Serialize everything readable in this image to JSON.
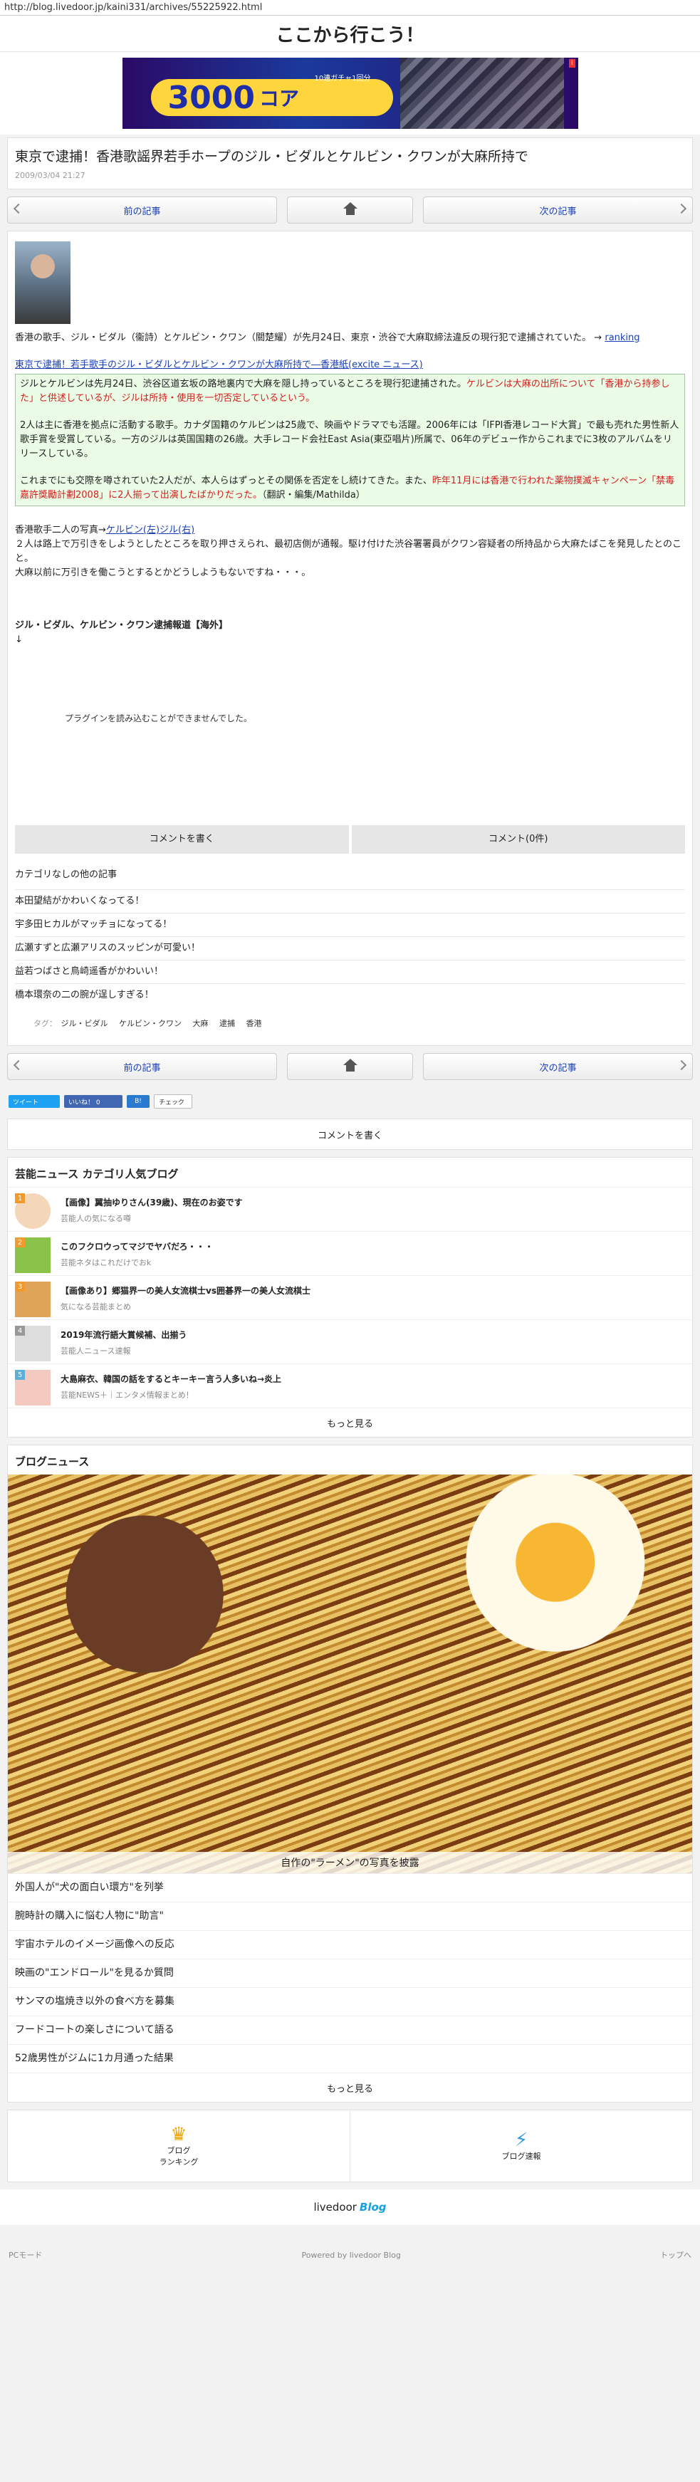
{
  "browser": {
    "url": "http://blog.livedoor.jp/kaini331/archives/55225922.html"
  },
  "site": {
    "title": "ここから行こう！"
  },
  "ad": {
    "number": "3000",
    "unit": "コア",
    "note": "10連ガチャ1回分"
  },
  "article": {
    "title": "東京で逮捕！香港歌謡界若手ホープのジル・ビダルとケルビン・クワンが大麻所持で",
    "date": "2009/03/04 21:27",
    "intro": "香港の歌手、ジル・ビダル（衞詩）とケルビン・クワン（關楚耀）が先月24日、東京・渋谷で大麻取締法違反の現行犯で逮捕されていた。",
    "ranking_arrow": "→",
    "ranking_link": "ranking",
    "source_link": "東京で逮捕！若手歌手のジル・ビダルとケルビン・クワンが大麻所持で―香港紙(excite ニュース)",
    "quote_p1_a": "ジルとケルビンは先月24日、渋谷区道玄坂の路地裏内で大麻を隠し持っているところを現行犯逮捕された。",
    "quote_p1_b": "ケルビンは大麻の出所について「香港から持参した」と供述しているが、ジルは所持・使用を一切否定しているという。",
    "quote_p2": "2人は主に香港を拠点に活動する歌手。カナダ国籍のケルビンは25歳で、映画やドラマでも活躍。2006年には「IFPI香港レコード大賞」で最も売れた男性新人歌手賞を受賞している。一方のジルは英国国籍の26歳。大手レコード会社East Asia(東亞唱片)所属で、06年のデビュー作からこれまでに3枚のアルバムをリリースしている。",
    "quote_p3_a": "これまでにも交際を噂されていた2人だが、本人らはずっとその関係を否定をし続けてきた。また、",
    "quote_p3_b": "昨年11月には香港で行われた薬物撲滅キャンペーン「禁毒嘉許獎勵計劃2008」に2人揃って出演したばかりだった。",
    "quote_p3_c": "（翻訳・編集/Mathilda）",
    "photo_line_text": "香港歌手二人の写真→",
    "photo_line_link": "ケルビン(左)ジル(右)",
    "comment1": "２人は路上で万引きをしようとしたところを取り押さえられ、最初店側が通報。駆け付けた渋谷署署員がクワン容疑者の所持品から大麻たばこを発見したとのこと。",
    "comment2": "大麻以前に万引きを働こうとするとかどうしようもないですね・・・。",
    "video_title": "ジル・ビダル、ケルビン・クワン逮捕報道【海外】",
    "video_arrow": "↓",
    "plugin_msg": "プラグインを読み込むことができませんでした。"
  },
  "nav": {
    "prev": "前の記事",
    "next": "次の記事"
  },
  "actions": {
    "write_comment": "コメントを書く",
    "comments_count": "コメント(0件)"
  },
  "category": {
    "title": "カテゴリなしの他の記事",
    "items": [
      "本田望結がかわいくなってる！",
      "宇多田ヒカルがマッチョになってる！",
      "広瀬すずと広瀬アリスのスッピンが可愛い！",
      "益若つばさと鳥崎遥香がかわいい！",
      "橋本環奈の二の腕が逞しすぎる！"
    ]
  },
  "tags": {
    "label": "タグ：",
    "items": [
      "ジル・ビダル",
      "ケルビン・クワン",
      "大麻",
      "逮捕",
      "香港"
    ]
  },
  "share": {
    "tweet": "ツイート",
    "like": "いいね！ 0",
    "hatena": "B!",
    "check": "チェック"
  },
  "blog_rank": {
    "title": "芸能ニュース カテゴリ人気ブログ",
    "items": [
      {
        "num": "1",
        "title": "【画像】翼抽ゆりさん(39歳)、現在のお姿です",
        "blog": "芸能人の気になる噂"
      },
      {
        "num": "2",
        "title": "このフクロウってマジでヤバだろ・・・",
        "blog": "芸能ネタはこれだけでおk"
      },
      {
        "num": "3",
        "title": "【画像あり】郷猫界一の美人女流棋士vs囲碁界一の美人女流棋士",
        "blog": "気になる芸能まとめ"
      },
      {
        "num": "4",
        "title": "2019年流行語大賞候補、出揃う",
        "blog": "芸能人ニュース速報"
      },
      {
        "num": "5",
        "title": "大島麻衣、韓国の話をするとキーキー言う人多いね→炎上",
        "blog": "芸能NEWS＋｜エンタメ情報まとめ！"
      }
    ],
    "more": "もっと見る"
  },
  "blog_news": {
    "title": "ブログニュース",
    "caption": "自作の\"ラーメン\"の写真を披露",
    "items": [
      "外国人が\"犬の面白い環方\"を列挙",
      "腕時計の購入に悩む人物に\"助言\"",
      "宇宙ホテルのイメージ画像への反応",
      "映画の\"エンドロール\"を見るか質問",
      "サンマの塩焼き以外の食べ方を募集",
      "フードコートの楽しさについて語る",
      "52歳男性がジムに1カ月通った結果"
    ],
    "more": "もっと見る"
  },
  "footer": {
    "ranking": "ブログ\nランキング",
    "express": "ブログ速報",
    "logo": "livedoor",
    "logo_blog": "Blog",
    "pc_mode": "PCモード",
    "powered": "Powered by livedoor Blog",
    "top": "トップへ"
  }
}
